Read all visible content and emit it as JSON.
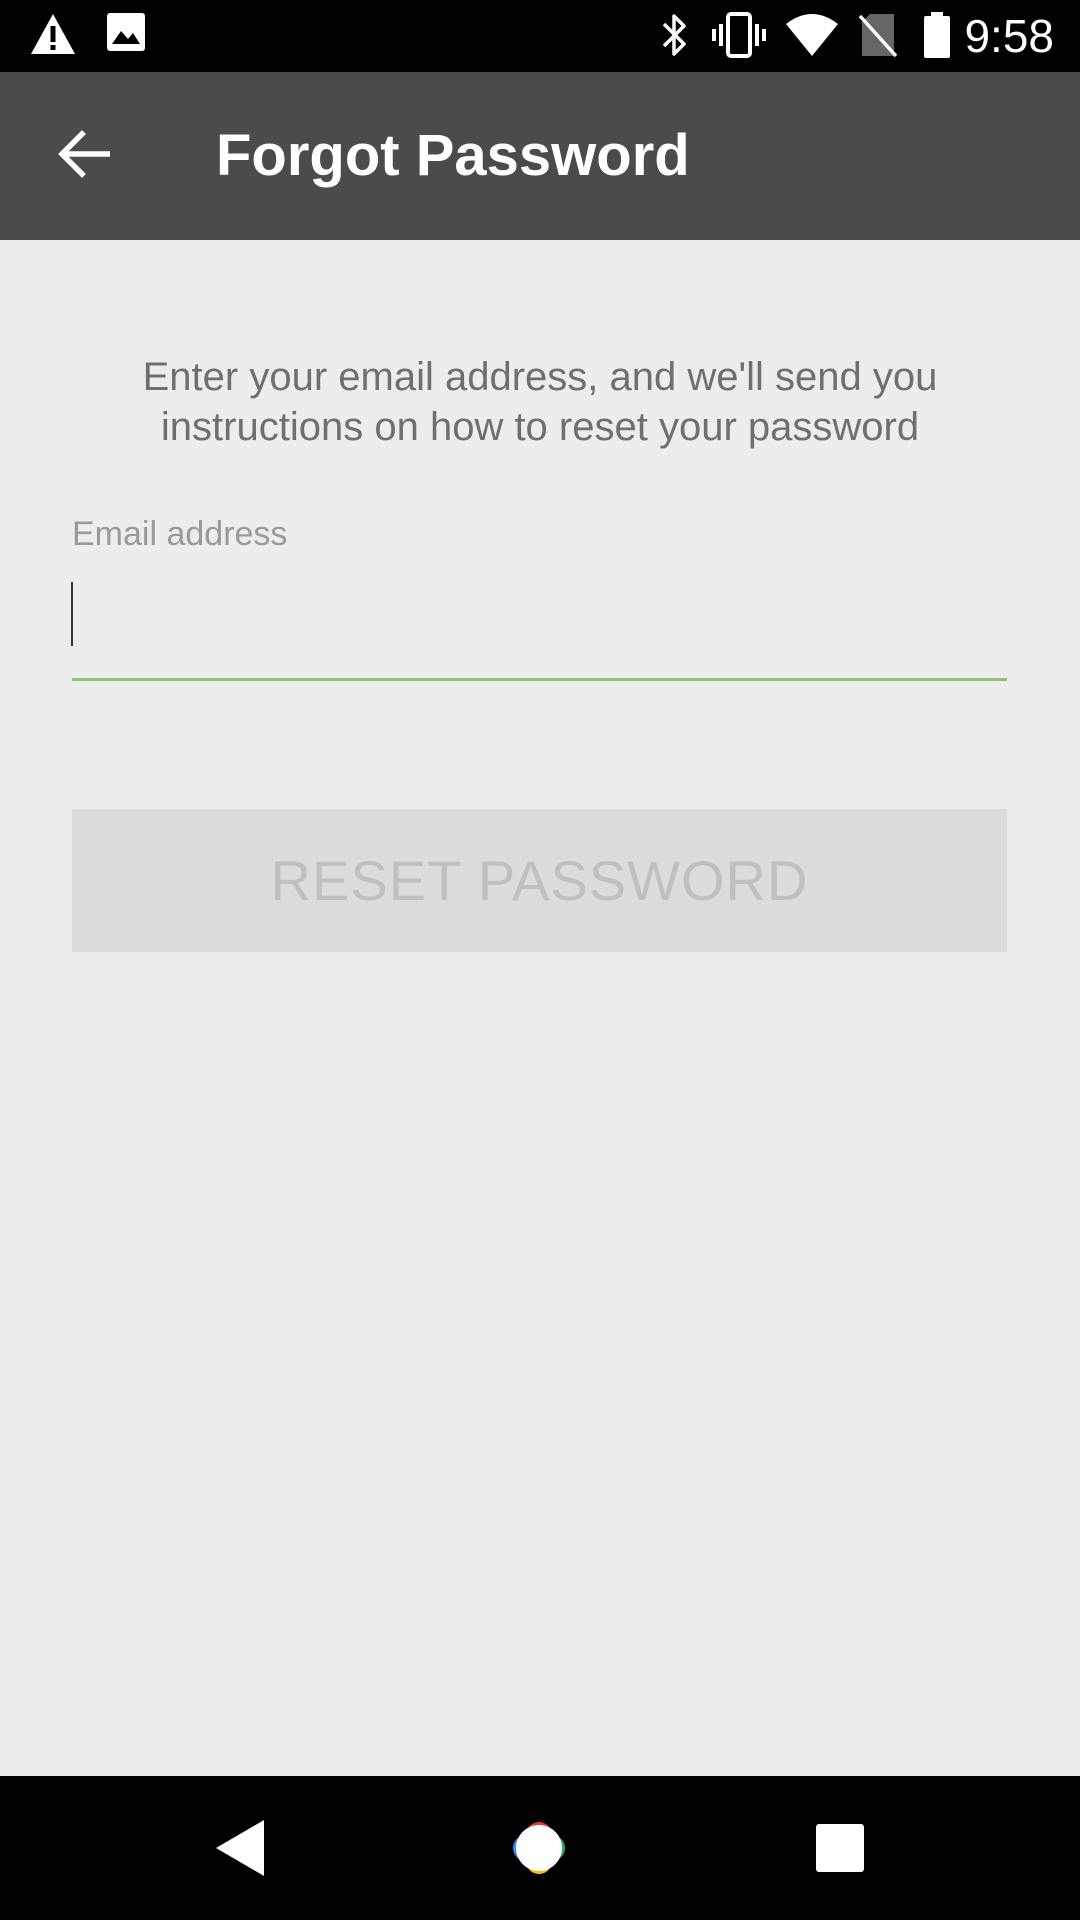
{
  "status_bar": {
    "time": "9:58",
    "icons": [
      "warning-icon",
      "image-icon",
      "bluetooth-icon",
      "vibrate-icon",
      "wifi-icon",
      "no-sim-icon",
      "battery-icon"
    ]
  },
  "toolbar": {
    "title": "Forgot Password",
    "back_icon": "arrow-back-icon"
  },
  "form": {
    "instructions": "Enter your email address, and we'll send you instructions on how to reset your password",
    "email_label": "Email address",
    "email_value": "",
    "reset_button_label": "RESET PASSWORD"
  },
  "colors": {
    "toolbar": "#4b4b4b",
    "background": "#ededed",
    "input_underline": "#8bc56e",
    "button_disabled_bg": "#dcdcdc",
    "button_disabled_text": "#c0c0c0"
  },
  "nav_bar": {
    "icons": [
      "nav-back-icon",
      "nav-home-icon",
      "nav-recents-icon"
    ]
  }
}
